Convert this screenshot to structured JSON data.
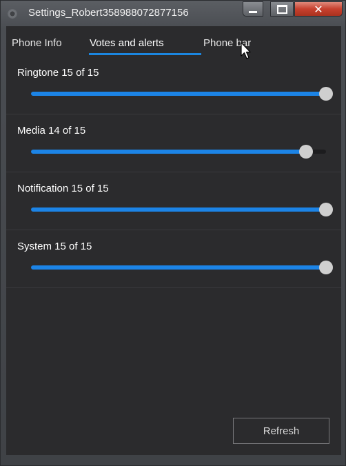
{
  "window": {
    "title": "Settings_Robert358988072877156",
    "close_glyph": "✕"
  },
  "tabs": [
    {
      "label": "Phone Info"
    },
    {
      "label": "Votes and alerts"
    },
    {
      "label": "Phone bar"
    }
  ],
  "volumes": [
    {
      "label": "Ringtone 15 of 15",
      "value": 15,
      "max": 15
    },
    {
      "label": "Media 14 of 15",
      "value": 14,
      "max": 15
    },
    {
      "label": "Notification 15 of 15",
      "value": 15,
      "max": 15
    },
    {
      "label": "System 15 of 15",
      "value": 15,
      "max": 15
    }
  ],
  "refresh_label": "Refresh",
  "colors": {
    "accent": "#1c84e6",
    "close_button": "#c7402e",
    "panel_background": "#2b2b2d"
  }
}
